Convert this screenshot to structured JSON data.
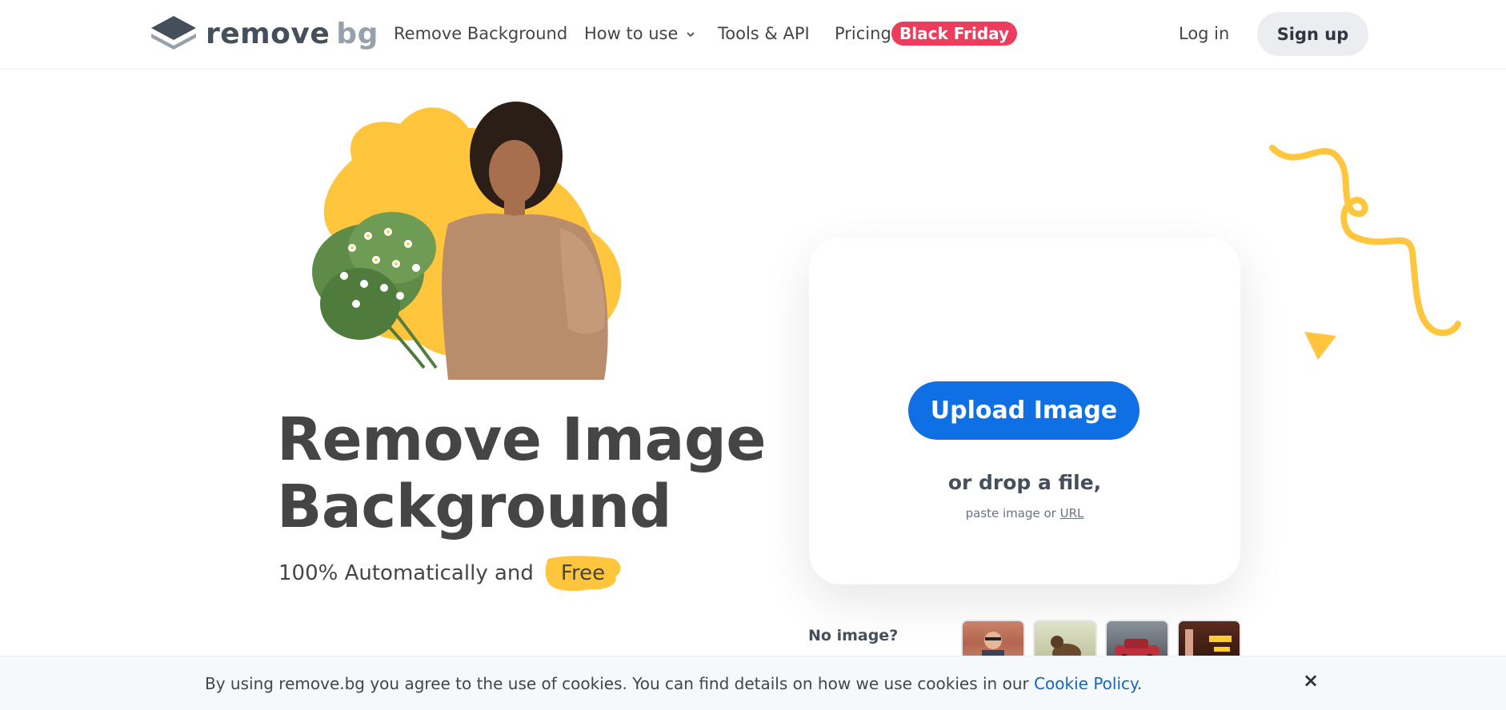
{
  "brand": {
    "name_main": "remove",
    "name_sub": "bg"
  },
  "nav": {
    "items": [
      "Remove Background",
      "How to use",
      "Tools & API",
      "Pricing"
    ],
    "badge": "Black Friday",
    "login": "Log in",
    "signup": "Sign up"
  },
  "hero": {
    "title_line1": "Remove Image",
    "title_line2": "Background",
    "subtitle": "100% Automatically and",
    "free": "Free"
  },
  "upload": {
    "button": "Upload Image",
    "drop": "or drop a file,",
    "paste": "paste image or",
    "url": "URL"
  },
  "samples": {
    "label": "No image?"
  },
  "cookie": {
    "text": "By using remove.bg you agree to the use of cookies. You can find details on how we use cookies in our",
    "link": "Cookie Policy",
    "suffix": ".",
    "close": "×"
  },
  "colors": {
    "accent": "#0f70e6",
    "badge": "#ee3c5d",
    "yellow": "#ffc53d"
  },
  "icons": [
    "logo-icon",
    "chevron-down-icon",
    "close-icon"
  ]
}
